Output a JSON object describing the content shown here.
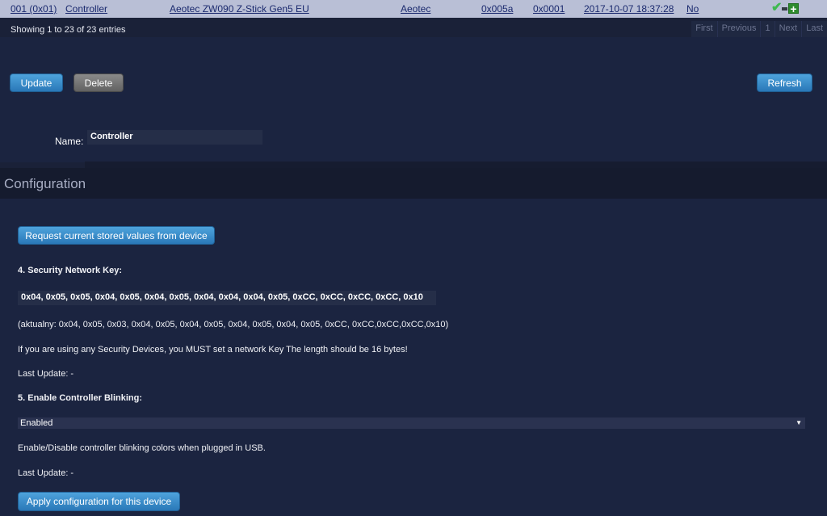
{
  "table_row": {
    "id": "001 (0x01)",
    "type": "Controller",
    "product": "Aeotec ZW090 Z-Stick Gen5 EU",
    "manufacturer": "Aeotec",
    "product_id": "0x005a",
    "product_type": "0x0001",
    "timestamp": "2017-10-07 18:37:28",
    "flag": "No"
  },
  "table_info": "Showing 1 to 23 of 23 entries",
  "pagination": {
    "first": "First",
    "previous": "Previous",
    "page": "1",
    "next": "Next",
    "last": "Last"
  },
  "actions": {
    "update": "Update",
    "delete": "Delete",
    "refresh": "Refresh"
  },
  "name_field": {
    "label": "Name:",
    "value": "Controller"
  },
  "configuration": {
    "title": "Configuration",
    "request_button": "Request current stored values from device",
    "param4": {
      "title": "4. Security Network Key:",
      "value": "0x04, 0x05, 0x05, 0x04, 0x05, 0x04, 0x05, 0x04, 0x04, 0x04, 0x05, 0xCC, 0xCC, 0xCC, 0xCC, 0x10",
      "current": "(aktualny: 0x04, 0x05, 0x03, 0x04, 0x05, 0x04, 0x05, 0x04, 0x05, 0x04, 0x05, 0xCC, 0xCC,0xCC,0xCC,0x10)",
      "help": "If you are using any Security Devices, you MUST set a network Key The length should be 16 bytes!",
      "last_update": "Last Update: -"
    },
    "param5": {
      "title": "5. Enable Controller Blinking:",
      "selected": "Enabled",
      "help": "Enable/Disable controller blinking colors when plugged in USB.",
      "last_update": "Last Update: -"
    },
    "apply_button": "Apply configuration for this device"
  },
  "icons": {
    "ok": "checkmark-icon",
    "remove": "minus-icon",
    "add": "plus-icon",
    "dropdown": "caret-down-icon"
  },
  "colors": {
    "row_highlight": "#b9bfd6",
    "panel_bg": "#1b2440",
    "button_blue": "#2a78b8",
    "button_gray": "#6e6e6e"
  }
}
